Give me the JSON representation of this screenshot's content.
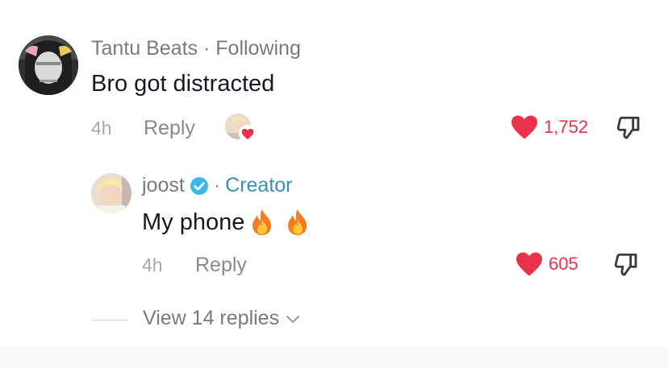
{
  "comment": {
    "username": "Tantu Beats",
    "separator": "·",
    "follow_status": "Following",
    "text": "Bro got distracted",
    "time": "4h",
    "reply_label": "Reply",
    "likes": "1,752",
    "avatar_icon": "user-avatar-photo",
    "liked_by_icon": "creator-liked-avatar"
  },
  "reply": {
    "username": "joost",
    "verified_icon": "verified-badge-icon",
    "separator": "·",
    "role": "Creator",
    "text": "My phone",
    "emojis": [
      "fire-icon",
      "fire-icon"
    ],
    "time": "4h",
    "reply_label": "Reply",
    "likes": "605"
  },
  "view_replies": {
    "label": "View 14 replies"
  },
  "colors": {
    "heart": "#e8334b",
    "creator": "#3c8fb3",
    "muted_text": "#7a7a7a",
    "main_text": "#161823"
  }
}
